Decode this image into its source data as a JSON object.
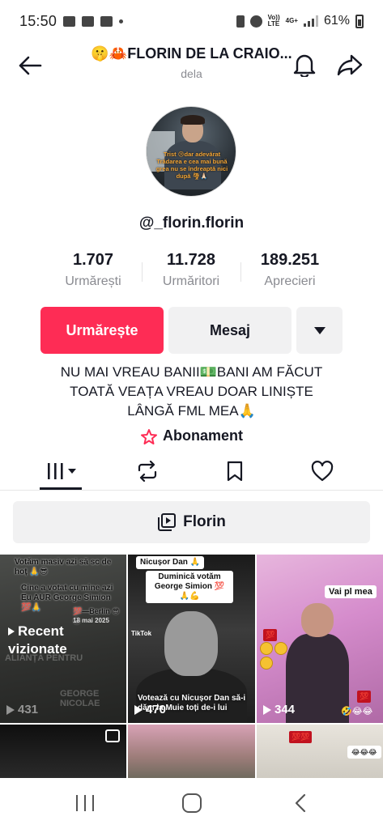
{
  "status_bar": {
    "time": "15:50",
    "volte": "Vo))",
    "lte": "LTE",
    "network": "4G+",
    "battery": "61%"
  },
  "header": {
    "title": "🤫🦀FLORIN DE LA CRAIO...",
    "subtitle": "dela"
  },
  "profile": {
    "avatar_text": "Trist 😢dar adevărat Trădarea e cea mai bună grea nu se îndreaptă nici după 🌪🙏🏻",
    "username": "@_florin.florin",
    "stats": [
      {
        "value": "1.707",
        "label": "Urmărești"
      },
      {
        "value": "11.728",
        "label": "Urmăritori"
      },
      {
        "value": "189.251",
        "label": "Aprecieri"
      }
    ],
    "follow_label": "Urmărește",
    "message_label": "Mesaj",
    "bio": "NU MAI VREAU BANII💵BANI AM FĂCUT\nTOATĂ VEAȚA VREAU DOAR LINIȘTE\nLÂNGĂ FML MEA🙏",
    "subscription_label": "Abonament"
  },
  "playlist": {
    "label": "Florin"
  },
  "grid": {
    "recent_label": "Recent\nvizionate",
    "items": [
      {
        "caption_top": "Votăm masiv azi să sc de hoț 🙏😎",
        "caption_mid": "Cine a votat cu mine azi Eu AUR George Simion 💯🙏",
        "caption_small": "💯—Berlin 😎😎",
        "date_text": "18 mai 2025",
        "views": "431"
      },
      {
        "caption_top": "Nicușor Dan 🙏",
        "caption_mid": "Duminică votăm George Simion 💯🙏💪",
        "caption_bottom": "Votează cu Nicușor Dan să-i dăm la Muie toți de-i lui",
        "tiktok_label": "TikTok",
        "views": "470"
      },
      {
        "caption_top": "Vai pl mea",
        "emojis": "🤣😂😂",
        "views": "344"
      }
    ]
  },
  "colors": {
    "accent": "#fe2c55",
    "secondary_button": "#f1f1f2",
    "text": "#161823",
    "muted": "#8a8b91"
  }
}
